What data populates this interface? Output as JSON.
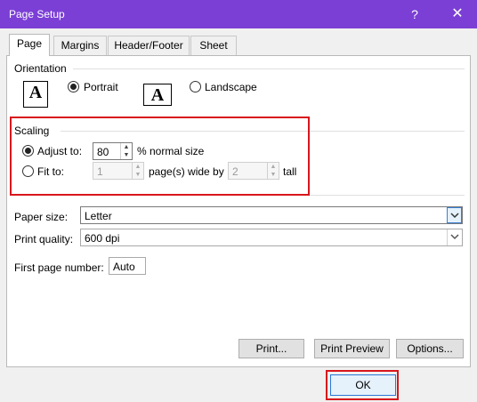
{
  "window": {
    "title": "Page Setup",
    "help_glyph": "?",
    "close_glyph": "✕"
  },
  "tabs": [
    "Page",
    "Margins",
    "Header/Footer",
    "Sheet"
  ],
  "orientation": {
    "label": "Orientation",
    "icon_letter": "A",
    "portrait_label": "Portrait",
    "landscape_label": "Landscape",
    "selected": "portrait"
  },
  "scaling": {
    "label": "Scaling",
    "adjust_label": "Adjust to:",
    "adjust_value": "80",
    "adjust_suffix": "% normal size",
    "fit_label": "Fit to:",
    "fit_wide_value": "1",
    "fit_wide_suffix": "page(s) wide by",
    "fit_tall_value": "2",
    "fit_tall_suffix": "tall",
    "selected": "adjust"
  },
  "paper": {
    "size_label": "Paper size:",
    "size_value": "Letter",
    "quality_label": "Print quality:",
    "quality_value": "600 dpi"
  },
  "first_page": {
    "label": "First page number:",
    "value": "Auto"
  },
  "buttons": {
    "print": "Print...",
    "print_preview": "Print Preview",
    "options": "Options...",
    "ok": "OK"
  },
  "colors": {
    "titlebar": "#7b3fd6",
    "highlight": "#d8161c",
    "accent": "#2a78d6"
  }
}
